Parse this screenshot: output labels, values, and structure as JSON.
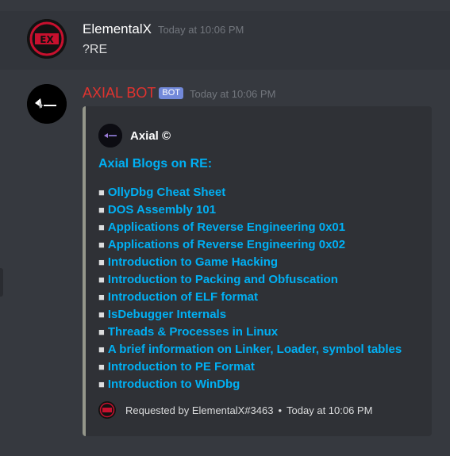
{
  "colors": {
    "background": "#36393f",
    "link": "#00b0f4",
    "bot_name": "#e0332f",
    "badge": "#7289da",
    "embed_bar": "#94968a"
  },
  "messages": [
    {
      "username": "ElementalX",
      "timestamp": "Today at 10:06 PM",
      "content": "?RE",
      "avatar_icon": "elementalx-avatar-icon"
    },
    {
      "username": "AXIAL BOT",
      "badge": "BOT",
      "timestamp": "Today at 10:06 PM",
      "avatar_icon": "axial-logo-icon"
    }
  ],
  "embed": {
    "author": "Axial ©",
    "title": "Axial Blogs on RE:",
    "bullet": "■",
    "links": [
      "OllyDbg Cheat Sheet",
      "DOS Assembly 101",
      "Applications of Reverse Engineering 0x01",
      "Applications of Reverse Engineering 0x02",
      "Introduction to Game Hacking",
      "Introduction to Packing and Obfuscation",
      "Introduction of ELF format",
      "IsDebugger Internals",
      "Threads & Processes in Linux",
      "A brief information on Linker, Loader, symbol tables",
      "Introduction to PE Format",
      "Introduction to WinDbg"
    ],
    "footer": {
      "text": "Requested by ElementalX#3463",
      "separator": "•",
      "timestamp": "Today at 10:06 PM"
    }
  }
}
